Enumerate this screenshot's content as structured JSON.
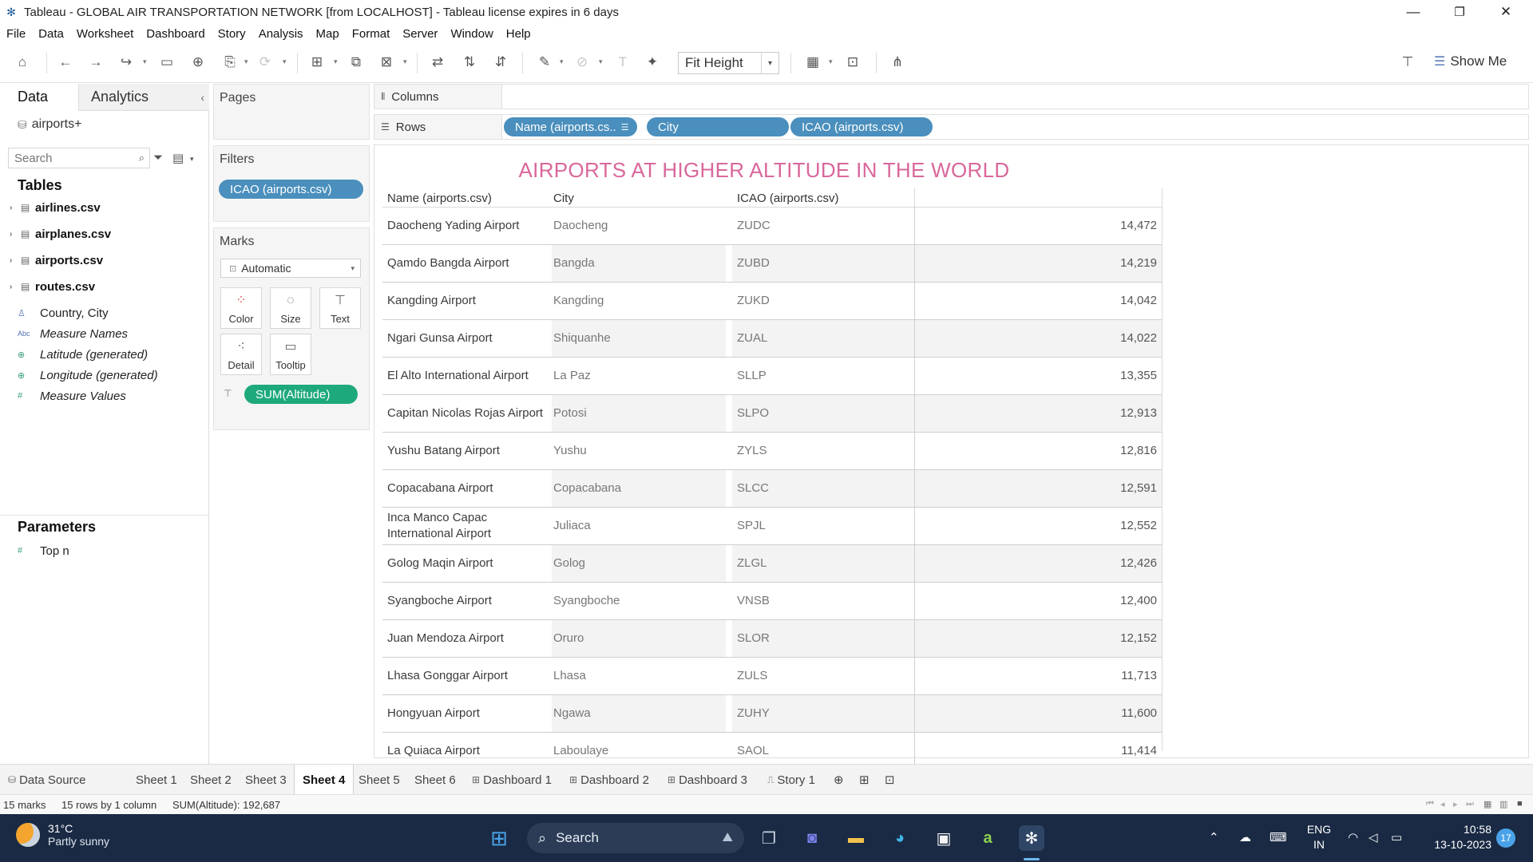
{
  "window": {
    "title": "Tableau - GLOBAL AIR TRANSPORTATION NETWORK [from LOCALHOST] - Tableau license expires in 6 days",
    "minimize": "—",
    "restore": "❐",
    "close": "✕"
  },
  "menu": [
    "File",
    "Data",
    "Worksheet",
    "Dashboard",
    "Story",
    "Analysis",
    "Map",
    "Format",
    "Server",
    "Window",
    "Help"
  ],
  "toolbar": {
    "fit_mode": "Fit Height",
    "show_me": "Show Me"
  },
  "data_pane": {
    "tab_data": "Data",
    "tab_analytics": "Analytics",
    "datasource": "airports+",
    "search_placeholder": "Search",
    "tables_heading": "Tables",
    "tables": [
      "airlines.csv",
      "airplanes.csv",
      "airports.csv",
      "routes.csv"
    ],
    "fields": [
      {
        "icon": "globe",
        "label": "Country, City",
        "italic": false
      },
      {
        "icon": "abc",
        "label": "Measure Names",
        "italic": true
      },
      {
        "icon": "globe",
        "label": "Latitude (generated)",
        "italic": true
      },
      {
        "icon": "hash",
        "label": "Longitude (generated)",
        "italic": true
      },
      {
        "icon": "hash",
        "label": "Measure Values",
        "italic": true
      }
    ],
    "parameters_heading": "Parameters",
    "parameters": [
      "Top n"
    ]
  },
  "cards": {
    "pages_title": "Pages",
    "filters_title": "Filters",
    "filter_pill": "ICAO (airports.csv)",
    "marks_title": "Marks",
    "marks_type": "Automatic",
    "mark_buttons": [
      "Color",
      "Size",
      "Text",
      "Detail",
      "Tooltip"
    ],
    "measure_pill": "SUM(Altitude)"
  },
  "shelves": {
    "columns_label": "Columns",
    "rows_label": "Rows",
    "row_pills": [
      "Name (airports.cs..",
      "City",
      "ICAO (airports.csv)"
    ]
  },
  "view": {
    "title": "AIRPORTS AT HIGHER ALTITUDE IN THE WORLD",
    "headers": [
      "Name (airports.csv)",
      "City",
      "ICAO (airports.csv)"
    ],
    "rows": [
      {
        "name": "Daocheng Yading Airport",
        "city": "Daocheng",
        "icao": "ZUDC",
        "value": "14,472"
      },
      {
        "name": "Qamdo Bangda Airport",
        "city": "Bangda",
        "icao": "ZUBD",
        "value": "14,219"
      },
      {
        "name": "Kangding Airport",
        "city": "Kangding",
        "icao": "ZUKD",
        "value": "14,042"
      },
      {
        "name": "Ngari Gunsa Airport",
        "city": "Shiquanhe",
        "icao": "ZUAL",
        "value": "14,022"
      },
      {
        "name": "El Alto International Airport",
        "city": "La Paz",
        "icao": "SLLP",
        "value": "13,355"
      },
      {
        "name": "Capitan Nicolas Rojas Airport",
        "city": "Potosi",
        "icao": "SLPO",
        "value": "12,913"
      },
      {
        "name": "Yushu Batang Airport",
        "city": "Yushu",
        "icao": "ZYLS",
        "value": "12,816"
      },
      {
        "name": "Copacabana Airport",
        "city": "Copacabana",
        "icao": "SLCC",
        "value": "12,591"
      },
      {
        "name": "Inca Manco Capac International Airport",
        "city": "Juliaca",
        "icao": "SPJL",
        "value": "12,552"
      },
      {
        "name": "Golog Maqin Airport",
        "city": "Golog",
        "icao": "ZLGL",
        "value": "12,426"
      },
      {
        "name": "Syangboche Airport",
        "city": "Syangboche",
        "icao": "VNSB",
        "value": "12,400"
      },
      {
        "name": "Juan Mendoza Airport",
        "city": "Oruro",
        "icao": "SLOR",
        "value": "12,152"
      },
      {
        "name": "Lhasa Gonggar Airport",
        "city": "Lhasa",
        "icao": "ZULS",
        "value": "11,713"
      },
      {
        "name": "Hongyuan Airport",
        "city": "Ngawa",
        "icao": "ZUHY",
        "value": "11,600"
      },
      {
        "name": "La Quiaca Airport",
        "city": "Laboulaye",
        "icao": "SAOL",
        "value": "11,414"
      }
    ]
  },
  "sheet_tabs": {
    "data_source": "Data Source",
    "tabs": [
      "Sheet 1",
      "Sheet 2",
      "Sheet 3",
      "Sheet 4",
      "Sheet 5",
      "Sheet 6",
      "Dashboard 1",
      "Dashboard 2",
      "Dashboard 3",
      "Story 1"
    ],
    "active": "Sheet 4"
  },
  "status": {
    "marks": "15 marks",
    "dims": "15 rows by 1 column",
    "sum": "SUM(Altitude): 192,687"
  },
  "taskbar": {
    "temp": "31°C",
    "weather": "Partly sunny",
    "search": "Search",
    "lang1": "ENG",
    "lang2": "IN",
    "time": "10:58",
    "date": "13-10-2023",
    "notifications": "17"
  }
}
